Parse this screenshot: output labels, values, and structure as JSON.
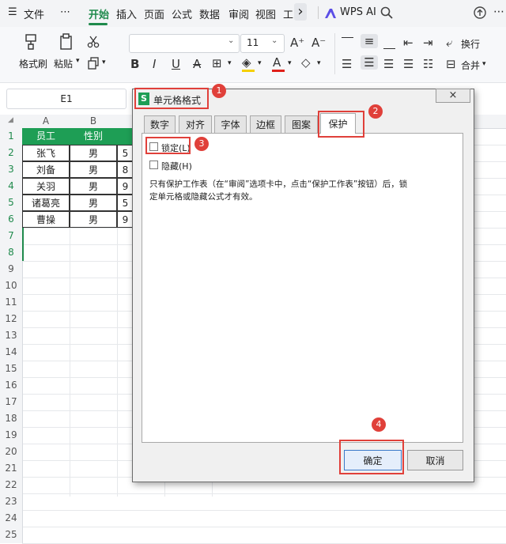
{
  "menubar": {
    "hamburger": "☰",
    "file": "文件",
    "more": "⋯",
    "tabs": [
      "开始",
      "插入",
      "页面",
      "公式",
      "数据",
      "审阅",
      "视图",
      "工"
    ],
    "nav_arrow": "›",
    "wps_ai": "WPS AI"
  },
  "ribbon": {
    "format_painter": "格式刷",
    "paste": "粘贴",
    "font_size": "11",
    "wrap": "换行",
    "merge": "合并"
  },
  "namebox": {
    "value": "E1"
  },
  "sheet": {
    "columns": [
      "A",
      "B"
    ],
    "rows": [
      "1",
      "2",
      "3",
      "4",
      "5",
      "6",
      "7",
      "8",
      "9",
      "10",
      "11",
      "12",
      "13",
      "14",
      "15",
      "16",
      "17",
      "18",
      "19",
      "20",
      "21",
      "22",
      "23",
      "24",
      "25"
    ],
    "header": [
      "员工",
      "性别"
    ],
    "data": [
      [
        "张飞",
        "男",
        "5"
      ],
      [
        "刘备",
        "男",
        "8"
      ],
      [
        "关羽",
        "男",
        "9"
      ],
      [
        "诸葛亮",
        "男",
        "5"
      ],
      [
        "曹操",
        "男",
        "9"
      ]
    ]
  },
  "dialog": {
    "icon_letter": "S",
    "title": "单元格格式",
    "close": "×",
    "tabs": [
      "数字",
      "对齐",
      "字体",
      "边框",
      "图案",
      "保护"
    ],
    "lock_label": "锁定(L)",
    "hide_label": "隐藏(H)",
    "note_line1": "只有保护工作表（在“审阅”选项卡中，点击“保护工作表”按钮）后，锁",
    "note_line2": "定单元格或隐藏公式才有效。",
    "ok": "确定",
    "cancel": "取消"
  },
  "annotations": [
    "1",
    "2",
    "3",
    "4"
  ],
  "colors": {
    "accent": "#1f8a4c",
    "header_fill": "#1e9e55",
    "highlight": "#e0403a"
  }
}
